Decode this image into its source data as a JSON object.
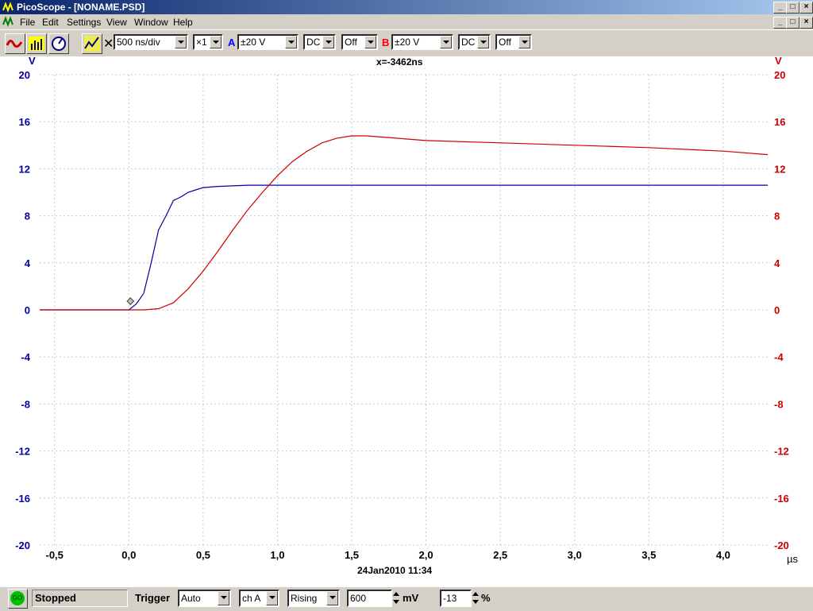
{
  "window": {
    "title": "PicoScope - [NONAME.PSD]"
  },
  "menu": {
    "items": [
      "File",
      "Edit",
      "Settings",
      "View",
      "Window",
      "Help"
    ]
  },
  "toolbar": {
    "timebase": "500 ns/div",
    "zoom": "×1",
    "channel_a": {
      "label": "A",
      "range": "±20 V",
      "coupling": "DC",
      "extra": "Off",
      "color": "#0000ff"
    },
    "channel_b": {
      "label": "B",
      "range": "±20 V",
      "coupling": "DC",
      "extra": "Off",
      "color": "#ff0000"
    }
  },
  "cursor_readout": "x=-3462ns",
  "timestamp": "24Jan2010  11:34",
  "status": {
    "go_label": "GO",
    "state": "Stopped",
    "trigger_label": "Trigger",
    "trigger_mode": "Auto",
    "trigger_channel": "ch A",
    "trigger_edge": "Rising",
    "threshold_value": "600",
    "threshold_unit": "mV",
    "delay_value": "-13",
    "delay_unit": "%"
  },
  "colors": {
    "channel_a": "#0000a0",
    "channel_b": "#cc0000",
    "grid": "#c8c8c8"
  },
  "chart_data": {
    "type": "line",
    "xlabel": "µs",
    "ylabel_left": "V",
    "ylabel_right": "V",
    "xlim": [
      -0.6,
      4.3
    ],
    "ylim": [
      -20,
      20
    ],
    "x_ticks": [
      -0.5,
      0.0,
      0.5,
      1.0,
      1.5,
      2.0,
      2.5,
      3.0,
      3.5,
      4.0
    ],
    "x_tick_labels": [
      "-0,5",
      "0,0",
      "0,5",
      "1,0",
      "1,5",
      "2,0",
      "2,5",
      "3,0",
      "3,5",
      "4,0"
    ],
    "y_ticks": [
      20,
      16,
      12,
      8,
      4,
      0,
      -4,
      -8,
      -12,
      -16,
      -20
    ],
    "grid": true,
    "trigger_marker": {
      "x": 0.0,
      "y": 0.6
    },
    "series": [
      {
        "name": "A",
        "color": "#0000a0",
        "x": [
          -0.6,
          0.0,
          0.05,
          0.1,
          0.15,
          0.2,
          0.25,
          0.3,
          0.35,
          0.4,
          0.45,
          0.5,
          0.6,
          0.8,
          1.0,
          1.5,
          2.0,
          2.5,
          3.0,
          3.5,
          4.0,
          4.3
        ],
        "y": [
          0.0,
          0.0,
          0.5,
          1.4,
          4.0,
          6.8,
          8.0,
          9.3,
          9.6,
          10.0,
          10.2,
          10.4,
          10.5,
          10.6,
          10.6,
          10.6,
          10.6,
          10.6,
          10.6,
          10.6,
          10.6,
          10.6
        ]
      },
      {
        "name": "B",
        "color": "#cc0000",
        "x": [
          -0.6,
          0.0,
          0.1,
          0.2,
          0.3,
          0.4,
          0.5,
          0.6,
          0.7,
          0.8,
          0.9,
          1.0,
          1.1,
          1.2,
          1.3,
          1.4,
          1.5,
          1.6,
          1.8,
          2.0,
          2.5,
          3.0,
          3.5,
          4.0,
          4.3
        ],
        "y": [
          0.0,
          0.0,
          0.0,
          0.1,
          0.6,
          1.8,
          3.3,
          5.0,
          6.8,
          8.5,
          10.0,
          11.4,
          12.6,
          13.5,
          14.2,
          14.6,
          14.8,
          14.8,
          14.6,
          14.4,
          14.2,
          14.0,
          13.8,
          13.5,
          13.2
        ]
      }
    ]
  }
}
